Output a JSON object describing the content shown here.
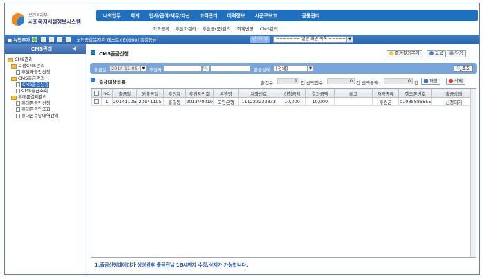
{
  "logo": {
    "small": "보건복지부",
    "big": "사회복지시설정보시스템"
  },
  "topnav": [
    "나의업무",
    "회계",
    "인사/급여/세무/자산",
    "고객관리",
    "이력정보",
    "시군구보고",
    "공통관리"
  ],
  "subnav": [
    "기초등록",
    "후원자관리",
    "후원금(품)관리",
    "회계반영",
    "CMS관리"
  ],
  "strip": {
    "new_tab": "■ 뉴탭추가",
    "page_tab": "노인종합복지관(테스트)[E0160]  홍길동님",
    "button": "닫기하위",
    "open_list": "======= 열린 화면 목록 ======"
  },
  "sidebar": {
    "title": "CMS관리",
    "items": [
      {
        "label": "CMS관리",
        "type": "folder",
        "indent": 0
      },
      {
        "label": "효성CMS관리",
        "type": "folder",
        "indent": 1
      },
      {
        "label": "후원자승인신청",
        "type": "doc",
        "indent": 2
      },
      {
        "label": "CMS출금관리",
        "type": "folder",
        "indent": 1
      },
      {
        "label": "CMS출금신청",
        "type": "doc",
        "indent": 2,
        "selected": true
      },
      {
        "label": "CMS출금조회",
        "type": "doc",
        "indent": 2
      },
      {
        "label": "휴대폰결제관리",
        "type": "folder",
        "indent": 1
      },
      {
        "label": "휴대폰승인신청",
        "type": "doc",
        "indent": 2
      },
      {
        "label": "휴대폰승인조회",
        "type": "doc",
        "indent": 2
      },
      {
        "label": "휴대폰수납내역관리",
        "type": "doc",
        "indent": 2
      }
    ]
  },
  "main": {
    "title": "CMS출금신청",
    "buttons": {
      "favorite": "즐겨찾기추가",
      "help": "도움",
      "close": "닫기"
    },
    "search": {
      "date_label": "출금일",
      "date_value": "2014-11-05",
      "donor_label": "후원자",
      "donor_value": "",
      "status_label": "출금상태",
      "status_value": "[전체]",
      "search_button": "조회"
    },
    "list": {
      "title": "출금대상목록",
      "count_label": "출건수:",
      "count_value": "1",
      "success_label": "건 선택건수:",
      "success_value": "0",
      "amount_label": "건 선택금액:",
      "amount_value": "0",
      "unit": "건",
      "save_button": "저장",
      "delete_button": "삭제"
    },
    "table": {
      "headers": [
        "No.",
        "출금일",
        "원출금일",
        "후원자",
        "후원자번호",
        "은행명",
        "계좌번호",
        "신청금액",
        "결과금액",
        "비고",
        "자금종류",
        "핸드폰번호",
        "출금상태"
      ],
      "rows": [
        [
          "1",
          "20141105",
          "20141105",
          "홍길동",
          "2013M0010",
          "국민은행",
          "111222233333",
          "10,000",
          "10,000",
          "",
          "후원금",
          "01088885555",
          "신청대기"
        ]
      ]
    },
    "notice": "1.출금신청데이터가 생성완후 출금전날 16시까지 수정,삭제가 가능합니다."
  }
}
